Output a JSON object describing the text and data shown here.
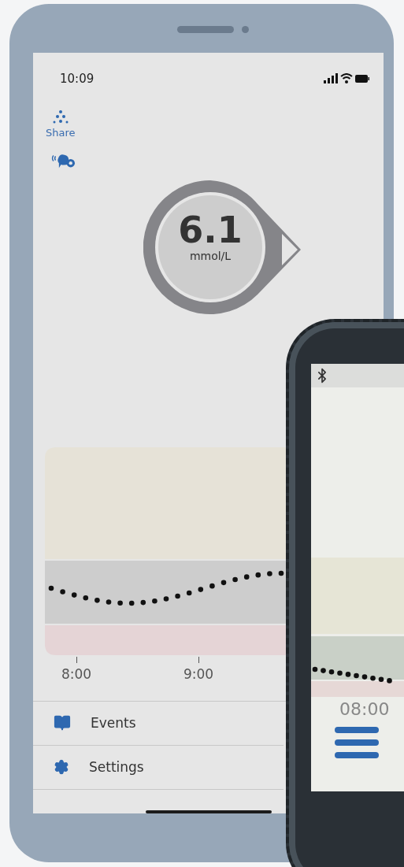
{
  "status_bar": {
    "time": "10:09"
  },
  "share": {
    "label": "Share"
  },
  "reading": {
    "value": "6.1",
    "unit": "mmol/L"
  },
  "graph": {
    "time_labels": [
      "8:00",
      "9:00"
    ]
  },
  "menu": [
    {
      "kind": "events",
      "label": "Events"
    },
    {
      "kind": "settings",
      "label": "Settings"
    }
  ],
  "second_device": {
    "time_labels": [
      "08:00"
    ]
  }
}
